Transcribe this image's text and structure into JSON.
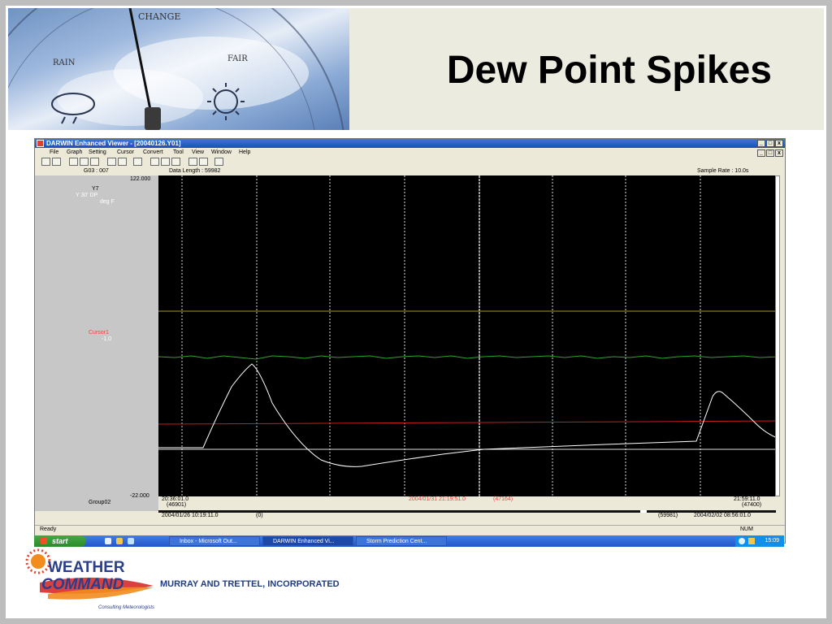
{
  "slide": {
    "title": "Dew Point Spikes",
    "barometer_labels": [
      "CHANGE",
      "RAIN",
      "FAIR"
    ]
  },
  "window": {
    "title": "DARWIN Enhanced Viewer - [20040126.Y01]",
    "controls": [
      "_",
      "□",
      "x"
    ],
    "menu": [
      "File",
      "Graph",
      "Setting",
      "Cursor",
      "Convert",
      "Tool",
      "View",
      "Window",
      "Help"
    ]
  },
  "graph": {
    "channel_id": "G03 : 007",
    "data_length": "Data Length : 59982",
    "sample_rate": "Sample Rate : 10.0s",
    "y_max": "122.000",
    "y_min": "-22.000",
    "channel_lines": [
      "Y7",
      "Y 30' DP",
      "deg F"
    ],
    "cursor_label": "Cursor1",
    "cursor_value": "-1.0",
    "group_label": "Group02",
    "start_time": "20:36:01.0",
    "start_index": "(46901)",
    "cursor_time": "2004/01/31 21:19:51.0",
    "cursor_index": "(47164)",
    "end_time": "21:59:11.0",
    "end_index": "(47400)",
    "range_start": "2004/01/26 10:19:11.0",
    "range_start_index": "(0)",
    "range_end_index": "(59981)",
    "range_end": "2004/02/02 08:56:01.0",
    "colors": {
      "background": "#000000",
      "trace_main": "#ffffff",
      "trace_green": "#2ea32e",
      "trace_red": "#c41c1c",
      "trace_yellow": "#a89a1e",
      "cursor_text": "#ff3b3b"
    }
  },
  "status": {
    "left": "Ready",
    "right": "NUM"
  },
  "taskbar": {
    "start": "start",
    "tasks": [
      "Inbox - Microsoft Out...",
      "DARWIN Enhanced Vi...",
      "Storm Prediction Cent..."
    ],
    "clock": "15:09"
  },
  "footer": {
    "logo_line1": "WEATHER",
    "logo_line2": "COMMAND",
    "logo_tagline": "Consulting Meteorologists",
    "company": "MURRAY AND TRETTEL, INCORPORATED"
  }
}
